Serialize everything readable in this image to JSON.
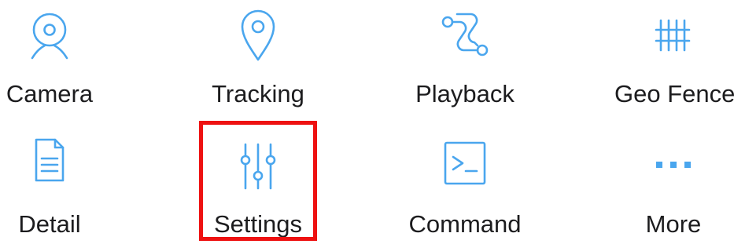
{
  "menu": {
    "items": [
      {
        "label": "Camera",
        "icon": "camera-icon"
      },
      {
        "label": "Tracking",
        "icon": "location-pin-icon"
      },
      {
        "label": "Playback",
        "icon": "route-icon"
      },
      {
        "label": "Geo Fence",
        "icon": "fence-icon"
      },
      {
        "label": "Detail",
        "icon": "document-icon"
      },
      {
        "label": "Settings",
        "icon": "sliders-icon"
      },
      {
        "label": "Command",
        "icon": "terminal-icon"
      },
      {
        "label": "More",
        "icon": "more-dots-icon"
      }
    ],
    "highlighted_item": "Settings"
  },
  "colors": {
    "icon": "#4aa6ee",
    "label": "#1c1c1e",
    "highlight": "#ee1111",
    "background": "#ffffff"
  }
}
